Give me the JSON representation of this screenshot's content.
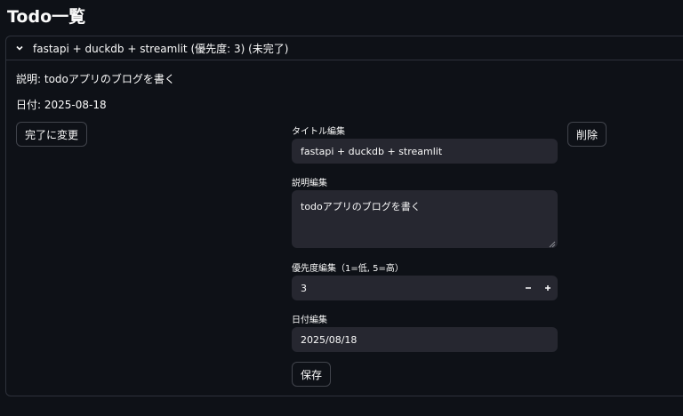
{
  "page": {
    "title": "Todo一覧"
  },
  "todo": {
    "header": "fastapi + duckdb + streamlit (優先度: 3) (未完了)",
    "description_line": "説明: todoアプリのブログを書く",
    "date_line": "日付: 2025-08-18",
    "complete_button": "完了に変更",
    "delete_button": "削除",
    "save_button": "保存",
    "title_label": "タイトル編集",
    "title_value": "fastapi + duckdb + streamlit",
    "desc_label": "説明編集",
    "desc_value": "todoアプリのブログを書く",
    "priority_label": "優先度編集（1=低, 5=高）",
    "priority_value": "3",
    "date_label": "日付編集",
    "date_value": "2025/08/18"
  },
  "icons": {
    "expander": "chevron-down-icon",
    "minus": "minus-icon",
    "plus": "plus-icon"
  }
}
